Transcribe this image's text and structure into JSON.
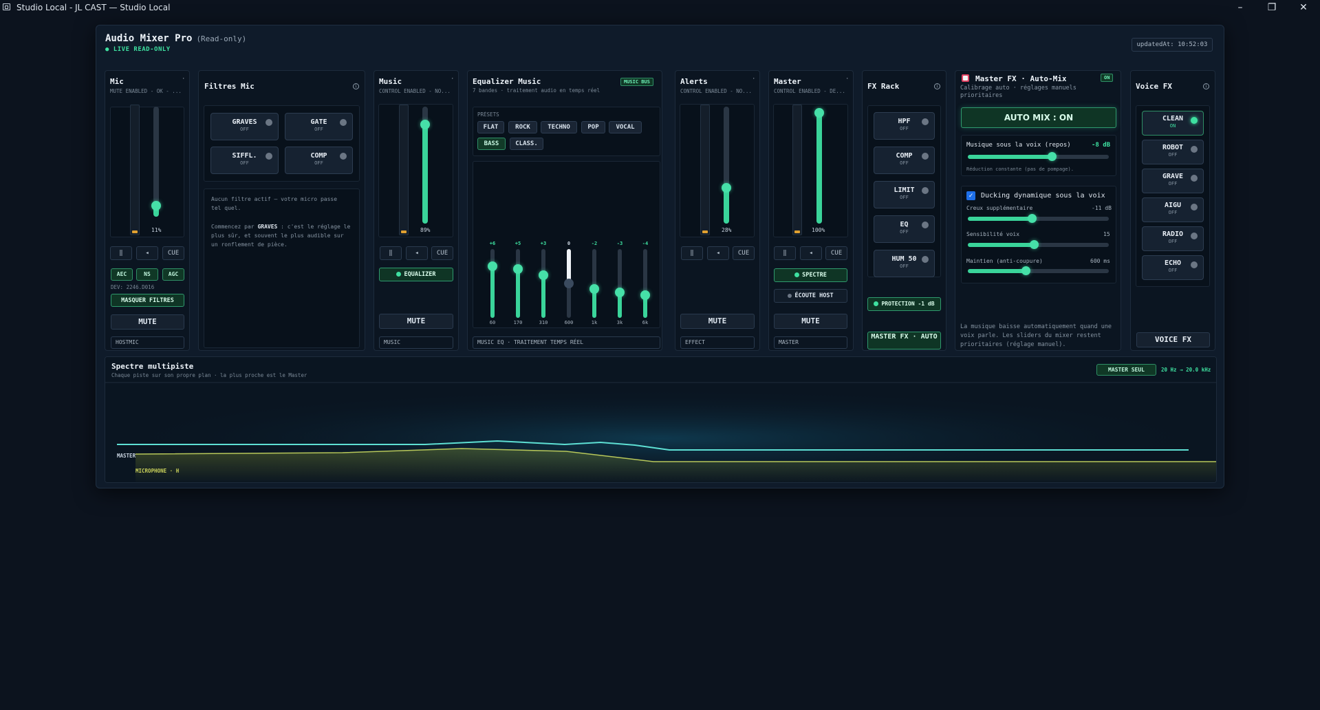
{
  "window": {
    "title": "Studio Local - JL CAST — Studio Local"
  },
  "header": {
    "title": "Audio Mixer Pro",
    "readonly": "(Read-only)",
    "live": "● LIVE READ-ONLY",
    "updated": "updatedAt: 10:52:03"
  },
  "mic": {
    "title": "Mic",
    "sub": "MUTE ENABLED - OK - ...",
    "level_pct": "11%",
    "level": 0.11,
    "cue": "CUE",
    "chips": [
      "AEC",
      "NS",
      "AGC"
    ],
    "dev": "DEV: 2246.D016",
    "mask": "MASQUER FILTRES",
    "mute": "MUTE",
    "label": "HOSTMIC"
  },
  "filters": {
    "title": "Filtres Mic",
    "buttons": [
      {
        "name": "GRAVES",
        "state": "OFF"
      },
      {
        "name": "GATE",
        "state": "OFF"
      },
      {
        "name": "SIFFL.",
        "state": "OFF"
      },
      {
        "name": "COMP",
        "state": "OFF"
      }
    ],
    "msg1": "Aucun filtre actif — votre micro passe tel quel.",
    "msg2_a": "Commencez par ",
    "msg2_b": "GRAVES",
    "msg2_c": " : c'est le réglage le plus sûr, et souvent le plus audible sur un ronflement de pièce."
  },
  "music": {
    "title": "Music",
    "sub": "CONTROL ENABLED - NO...",
    "level_pct": "89%",
    "level": 0.89,
    "cue": "CUE",
    "eq_btn": "EQUALIZER",
    "mute": "MUTE",
    "label": "MUSIC"
  },
  "eq": {
    "title": "Equalizer Music",
    "sub": "7 bandes · traitement audio en temps réel",
    "badge": "MUSIC BUS",
    "presets_label": "PRÉSETS",
    "presets": [
      "FLAT",
      "ROCK",
      "TECHNO",
      "POP",
      "VOCAL",
      "BASS",
      "CLASS."
    ],
    "active_preset": "BASS",
    "bands": [
      {
        "gain": "+6",
        "freq": "60",
        "value": 6
      },
      {
        "gain": "+5",
        "freq": "170",
        "value": 5
      },
      {
        "gain": "+3",
        "freq": "310",
        "value": 3
      },
      {
        "gain": "0",
        "freq": "600",
        "value": 0
      },
      {
        "gain": "-2",
        "freq": "1k",
        "value": -2
      },
      {
        "gain": "-3",
        "freq": "3k",
        "value": -3
      },
      {
        "gain": "-4",
        "freq": "6k",
        "value": -4
      }
    ],
    "footer": "MUSIC EQ · TRAITEMENT TEMPS RÉEL"
  },
  "alerts": {
    "title": "Alerts",
    "sub": "CONTROL ENABLED - NO...",
    "level_pct": "28%",
    "level": 0.28,
    "cue": "CUE",
    "mute": "MUTE",
    "label": "EFFECT"
  },
  "master": {
    "title": "Master",
    "sub": "CONTROL ENABLED - DE...",
    "level_pct": "100%",
    "level": 1.0,
    "cue": "CUE",
    "spectre": "SPECTRE",
    "ecoute": "ÉCOUTE HOST",
    "mute": "MUTE",
    "label": "MASTER"
  },
  "fxrack": {
    "title": "FX Rack",
    "buttons": [
      {
        "name": "HPF",
        "state": "OFF"
      },
      {
        "name": "COMP",
        "state": "OFF"
      },
      {
        "name": "LIMIT",
        "state": "OFF"
      },
      {
        "name": "EQ",
        "state": "OFF"
      },
      {
        "name": "HUM 50",
        "state": "OFF"
      }
    ],
    "protection": "PROTECTION -1 dB",
    "masterfx": "MASTER FX · AUTO"
  },
  "automix": {
    "title": "Master FX · Auto-Mix",
    "badge": "ON",
    "sub": "Calibrage auto · réglages manuels prioritaires",
    "button": "AUTO MIX : ON",
    "music_under": "Musique sous la voix (repos)",
    "music_under_val": "-8 dB",
    "music_under_level": 0.6,
    "music_note": "Réduction constante (pas de pompage).",
    "ducking": "Ducking dynamique sous la voix",
    "creux": "Creux supplémentaire",
    "creux_val": "-11 dB",
    "creux_level": 0.45,
    "sens": "Sensibilité voix",
    "sens_val": "15",
    "sens_level": 0.47,
    "maintien": "Maintien (anti-coupure)",
    "maintien_val": "600 ms",
    "maintien_level": 0.41,
    "note": "La musique baisse automatiquement quand une voix parle. Les sliders du mixer restent prioritaires (réglage manuel)."
  },
  "voicefx": {
    "title": "Voice FX",
    "buttons": [
      {
        "name": "CLEAN",
        "state": "ON"
      },
      {
        "name": "ROBOT",
        "state": "OFF"
      },
      {
        "name": "GRAVE",
        "state": "OFF"
      },
      {
        "name": "AIGU",
        "state": "OFF"
      },
      {
        "name": "RADIO",
        "state": "OFF"
      },
      {
        "name": "ECHO",
        "state": "OFF"
      }
    ],
    "footer": "VOICE FX"
  },
  "spectrum": {
    "title": "Spectre multipiste",
    "sub": "Chaque piste sur son propre plan · la plus proche est le Master",
    "btn": "MASTER SEUL",
    "range": "20 Hz → 20.0 kHz",
    "tracks": [
      "MASTER",
      "MICROPHONE · H"
    ],
    "colors": {
      "master": "#5ee0d4",
      "mic": "#b8c85a"
    }
  },
  "colors": {
    "accent": "#3ee0a0",
    "bg": "#0c131e",
    "panel": "#0f1b2a"
  }
}
